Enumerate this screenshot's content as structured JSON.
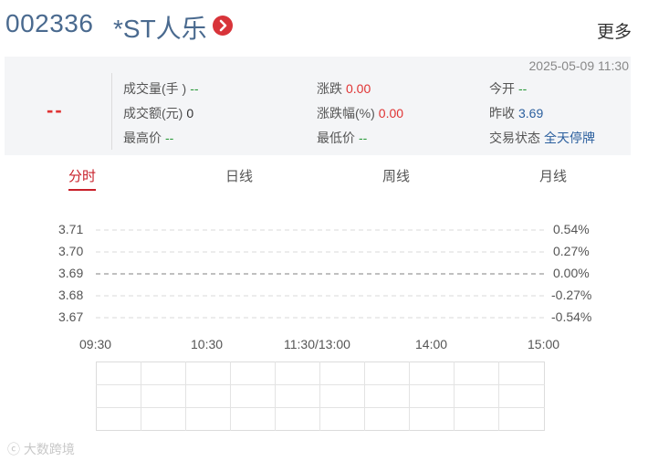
{
  "header": {
    "code": "002336",
    "name": "*ST人乐",
    "more_label": "更多"
  },
  "quote": {
    "timestamp": "2025-05-09 11:30",
    "price": "--",
    "fields": [
      {
        "label": "成交量(手 )",
        "value": "--"
      },
      {
        "label": "成交额(元)",
        "value": "0"
      },
      {
        "label": "最高价",
        "value": "--"
      },
      {
        "label": "涨跌",
        "value": "0.00"
      },
      {
        "label": "涨跌幅(%)",
        "value": "0.00"
      },
      {
        "label": "最低价",
        "value": "--"
      },
      {
        "label": "今开",
        "value": "--"
      },
      {
        "label": "昨收",
        "value": "3.69"
      },
      {
        "label": "交易状态",
        "value": "全天停牌"
      }
    ]
  },
  "tabs": [
    "分时",
    "日线",
    "周线",
    "月线"
  ],
  "active_tab": "分时",
  "chart_data": {
    "type": "line",
    "y_ticks": [
      "3.71",
      "3.70",
      "3.69",
      "3.68",
      "3.67"
    ],
    "y_pct_ticks": [
      "0.54%",
      "0.27%",
      "0.00%",
      "-0.27%",
      "-0.54%"
    ],
    "x_ticks": [
      "09:30",
      "10:30",
      "11:30/13:00",
      "14:00",
      "15:00"
    ],
    "ylim": [
      3.67,
      3.71
    ],
    "baseline": 3.69,
    "series": [],
    "grid": true
  },
  "colors": {
    "accent": "#c8202a",
    "code": "#4a6a8f",
    "up": "#e03333",
    "flat": "#2a9a3a",
    "status": "#2b5f9e"
  },
  "watermark": "大数跨境"
}
